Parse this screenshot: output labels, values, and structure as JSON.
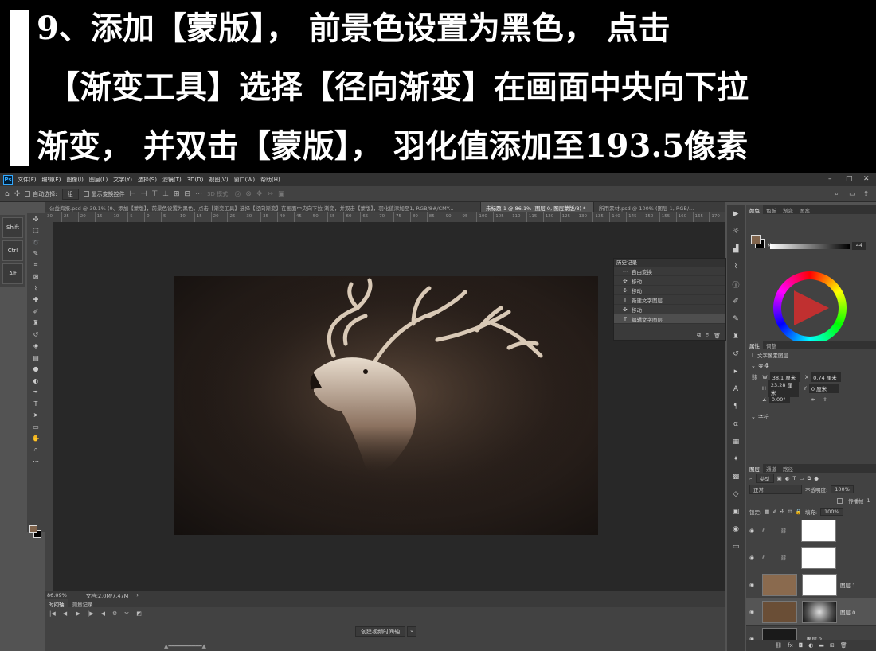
{
  "banner": {
    "line1": "9、添加【蒙版】，  前景色设置为黑色，  点击",
    "line2": "【渐变工具】选择【径向渐变】在画面中央向下拉",
    "line3": "渐变，  并双击【蒙版】，  羽化值添加至193.5像素"
  },
  "menubar": {
    "logo": "Ps",
    "items": [
      "文件(F)",
      "编辑(E)",
      "图像(I)",
      "图层(L)",
      "文字(Y)",
      "选择(S)",
      "滤镜(T)",
      "3D(D)",
      "视图(V)",
      "窗口(W)",
      "帮助(H)"
    ]
  },
  "options": {
    "auto_select": "自动选择:",
    "auto_select_value": "组",
    "show_transform": "显示变换控件",
    "mode_3d": "3D 模式:"
  },
  "tabs": [
    {
      "label": "公益海报.psd @ 39.1% (9、添加【蒙版】，前景色设置为黑色，点击【渐变工具】选择【径向渐变】在画面中央向下拉 渐变，并双击【蒙版】，羽化值添加至1, RGB/8#/CMY...",
      "active": false
    },
    {
      "label": "未标题-1 @ 86.1% (图层 0, 图层蒙版/8) *",
      "active": true
    },
    {
      "label": "所用素材.psd @ 100% (图层 1, RGB/...",
      "active": false
    }
  ],
  "modkeys": [
    "Shift",
    "Ctrl",
    "Alt"
  ],
  "ruler": {
    "ticks": [
      "30",
      "25",
      "20",
      "15",
      "10",
      "5",
      "0",
      "5",
      "10",
      "15",
      "20",
      "25",
      "30",
      "35",
      "40",
      "45",
      "50",
      "55",
      "60",
      "65",
      "70",
      "75",
      "80",
      "85",
      "90",
      "95",
      "100",
      "105",
      "110",
      "115",
      "120",
      "125",
      "130",
      "135",
      "140",
      "145",
      "150",
      "155",
      "160",
      "165",
      "170"
    ]
  },
  "history": {
    "title": "历史记录",
    "rows": [
      {
        "icon": "⋯",
        "label": "自由变换",
        "selected": false
      },
      {
        "icon": "✣",
        "label": "移动",
        "selected": false
      },
      {
        "icon": "✣",
        "label": "移动",
        "selected": false
      },
      {
        "icon": "T",
        "label": "新建文字图层",
        "selected": false
      },
      {
        "icon": "✣",
        "label": "移动",
        "selected": false
      },
      {
        "icon": "T",
        "label": "编辑文字图层",
        "selected": true
      }
    ]
  },
  "status": {
    "zoom": "86.09%",
    "doc": "文档:2.0M/7.47M"
  },
  "timeline": {
    "tabs": [
      "时间轴",
      "测量记录"
    ],
    "create_button": "创建视频时间轴"
  },
  "color_panel": {
    "tabs": [
      "颜色",
      "色板",
      "渐变",
      "图案"
    ],
    "k_label": "K",
    "k_value": "44",
    "colors": {
      "fg": "#80644c",
      "bg": "#000000"
    }
  },
  "properties": {
    "tabs": [
      "属性",
      "调整"
    ],
    "layer_type": "文字像素图层",
    "transform_title": "变换",
    "w_label": "W",
    "w_value": "38.1 厘米",
    "x_label": "X",
    "x_value": "0.74 厘米",
    "h_label": "H",
    "h_value": "23.28 厘米",
    "y_label": "Y",
    "y_value": "0 厘米",
    "angle_value": "0.00°",
    "char_title": "字符"
  },
  "layers": {
    "tabs": [
      "图层",
      "通道",
      "路径"
    ],
    "filter_kind": "类型",
    "blend_mode": "正常",
    "opacity_label": "不透明度:",
    "opacity_value": "100%",
    "lock_label": "锁定:",
    "fill_label": "填充:",
    "fill_value": "100%",
    "propagate": "传播帧",
    "propagate_value": "1",
    "items": [
      {
        "name": "",
        "thumb": "#ffffff",
        "mask": "#ffffff",
        "selected": false
      },
      {
        "name": "",
        "thumb": "#ffffff",
        "mask": "#ffffff",
        "selected": false
      },
      {
        "name": "图层 1",
        "thumb": "#8a6a4e",
        "mask": "#ffffff",
        "selected": false
      },
      {
        "name": "图层 0",
        "thumb": "#6a4e36",
        "mask": "#888888",
        "selected": true
      },
      {
        "name": "图层 2",
        "thumb": "#1a1a1a",
        "mask": "",
        "selected": false
      }
    ]
  }
}
